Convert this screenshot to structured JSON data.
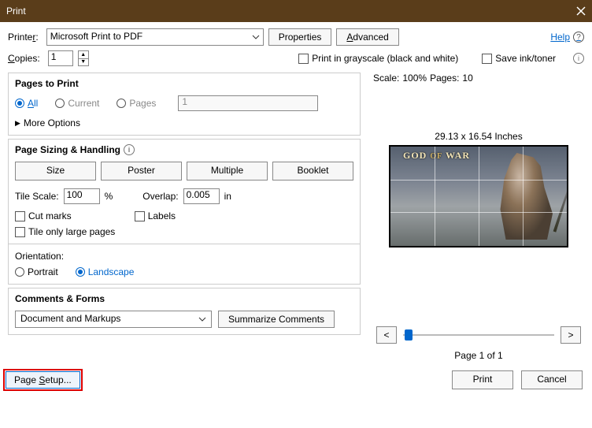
{
  "window": {
    "title": "Print"
  },
  "toolbar": {
    "printer_label_pre": "Printe",
    "printer_label_u": "r",
    "printer_label_post": ":",
    "printer_value": "Microsoft Print to PDF",
    "properties_label": "Properties",
    "advanced_pre": "",
    "advanced_u": "A",
    "advanced_post": "dvanced",
    "help_label": "Help"
  },
  "copies": {
    "label_pre": "",
    "label_u": "C",
    "label_post": "opies:",
    "value": "1",
    "grayscale_label": "Print in grayscale (black and white)",
    "saveink_label": "Save ink/toner"
  },
  "pages_panel": {
    "title": "Pages to Print",
    "all_u": "A",
    "all_post": "ll",
    "current_label": "Current",
    "pages_label": "Pages",
    "pages_value": "1",
    "more_options": "More Options"
  },
  "sizing": {
    "title": "Page Sizing & Handling",
    "size": "Size",
    "poster": "Poster",
    "multiple": "Multiple",
    "booklet": "Booklet",
    "tilescale_label": "Tile Scale:",
    "tilescale_value": "100",
    "percent": "%",
    "overlap_label": "Overlap:",
    "overlap_value": "0.005",
    "overlap_unit": "in",
    "cutmarks": "Cut marks",
    "labels": "Labels",
    "largepages": "Tile only large pages"
  },
  "orientation": {
    "title": "Orientation:",
    "portrait": "Portrait",
    "landscape": "Landscape"
  },
  "comments": {
    "title": "Comments & Forms",
    "dropdown_value": "Document and Markups",
    "summarize": "Summarize Comments"
  },
  "preview": {
    "scale_label": "Scale:",
    "scale_value": "100%",
    "pages_label": "Pages:",
    "pages_value": "10",
    "dimensions": "29.13 x 16.54 Inches",
    "logo_pre": "GOD",
    "logo_mid": "OF",
    "logo_post": "WAR",
    "page_of": "Page 1 of 1"
  },
  "bottom": {
    "page_setup_pre": "Page ",
    "page_setup_u": "S",
    "page_setup_post": "etup...",
    "print": "Print",
    "cancel": "Cancel"
  }
}
